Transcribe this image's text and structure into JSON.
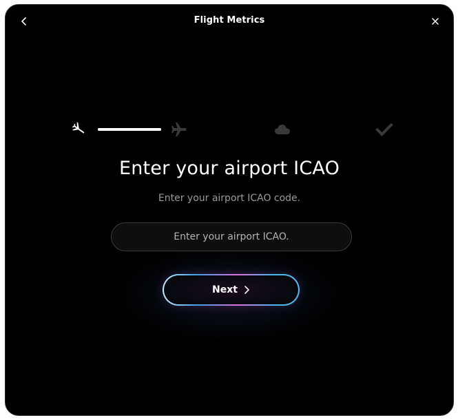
{
  "window": {
    "title": "Flight Metrics"
  },
  "stepper": {
    "steps": [
      {
        "icon": "plane-landing-icon",
        "state": "active"
      },
      {
        "icon": "plane-icon",
        "state": "inactive"
      },
      {
        "icon": "cloud-icon",
        "state": "inactive"
      },
      {
        "icon": "checkmark-icon",
        "state": "inactive"
      }
    ]
  },
  "main": {
    "heading": "Enter your airport ICAO",
    "subheading": "Enter your airport ICAO code.",
    "input": {
      "value": "",
      "placeholder": "Enter your airport ICAO."
    },
    "next_label": "Next"
  },
  "colors": {
    "background": "#000000",
    "text": "#ffffff",
    "muted_text": "#9a9a9a",
    "inactive_icon": "#3a3a3a",
    "gradient_blue": "#3aa0e8",
    "gradient_pink": "#e070e0"
  }
}
